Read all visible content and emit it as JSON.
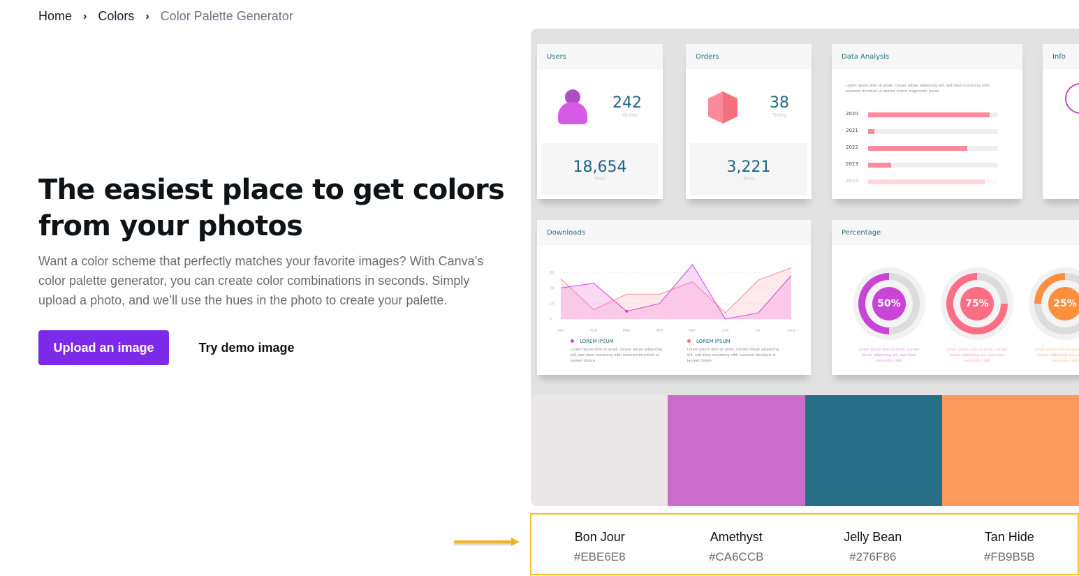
{
  "breadcrumb": {
    "items": [
      "Home",
      "Colors"
    ],
    "current": "Color Palette Generator"
  },
  "hero": {
    "title": "The easiest place to get colors from your photos",
    "description": "Want a color scheme that perfectly matches your favorite images? With Canva’s color palette generator, you can create color combinations in seconds. Simply upload a photo, and we’ll use the hues in the photo to create your palette.",
    "upload_label": "Upload an image",
    "demo_label": "Try demo image",
    "accent": "#7D2AE8"
  },
  "preview": {
    "users": {
      "title": "Users",
      "value": "242",
      "sub": "Online",
      "total": "18,654",
      "total_label": "Total"
    },
    "orders": {
      "title": "Orders",
      "value": "38",
      "sub": "Today",
      "total": "3,221",
      "total_label": "Total"
    },
    "analysis": {
      "title": "Data Analysis",
      "text": "Lorem ipsum dolo sit amet, consec tetuer adipiscing elit, sed diam nonummy nibh euismod tincidunt ut laoreet dolore magnorem ipsum",
      "rows": [
        {
          "year": "2020",
          "value": 0.94
        },
        {
          "year": "2021",
          "value": 0.05
        },
        {
          "year": "2022",
          "value": 0.77
        },
        {
          "year": "2023",
          "value": 0.18
        },
        {
          "year": "2024",
          "value": 0.9
        }
      ]
    },
    "info": {
      "title": "Info"
    },
    "downloads": {
      "title": "Downloads",
      "y_ticks": [
        "0",
        "10",
        "20",
        "30"
      ],
      "months": [
        "JAN",
        "FEB",
        "MAR",
        "APR",
        "MAY",
        "JUN",
        "JUL",
        "AUG"
      ],
      "series_a": [
        20,
        23,
        5,
        10,
        35,
        0,
        4,
        28
      ],
      "series_b": [
        26,
        6,
        16,
        16,
        24,
        4,
        25,
        33
      ],
      "legend": [
        {
          "label": "LOREM IPSUM",
          "color": "#CC44DD"
        },
        {
          "label": "LOREM IPSUM",
          "color": "#FB6E84"
        }
      ],
      "legend_text": "Lorem ipsum dolo sit amet, consec tetuer adipiscing elit, sed diam nonummy nibh euismod tincidunt ut laoreet dolore"
    },
    "percentage": {
      "title": "Percentage",
      "items": [
        {
          "label": "50%",
          "value": 50,
          "color": "#C845D6"
        },
        {
          "label": "75%",
          "value": 75,
          "color": "#FB6E84"
        },
        {
          "label": "25%",
          "value": 25,
          "color": "#FB8F3E"
        }
      ],
      "text": "Lorem ipsum dolo sit amet, consec tetuer adipiscing elit, sed diam nonummy nibh"
    }
  },
  "palette": [
    {
      "name": "Bon Jour",
      "hex": "#EBE6E8"
    },
    {
      "name": "Amethyst",
      "hex": "#CA6CCB"
    },
    {
      "name": "Jelly Bean",
      "hex": "#276F86"
    },
    {
      "name": "Tan Hide",
      "hex": "#FB9B5B"
    }
  ]
}
